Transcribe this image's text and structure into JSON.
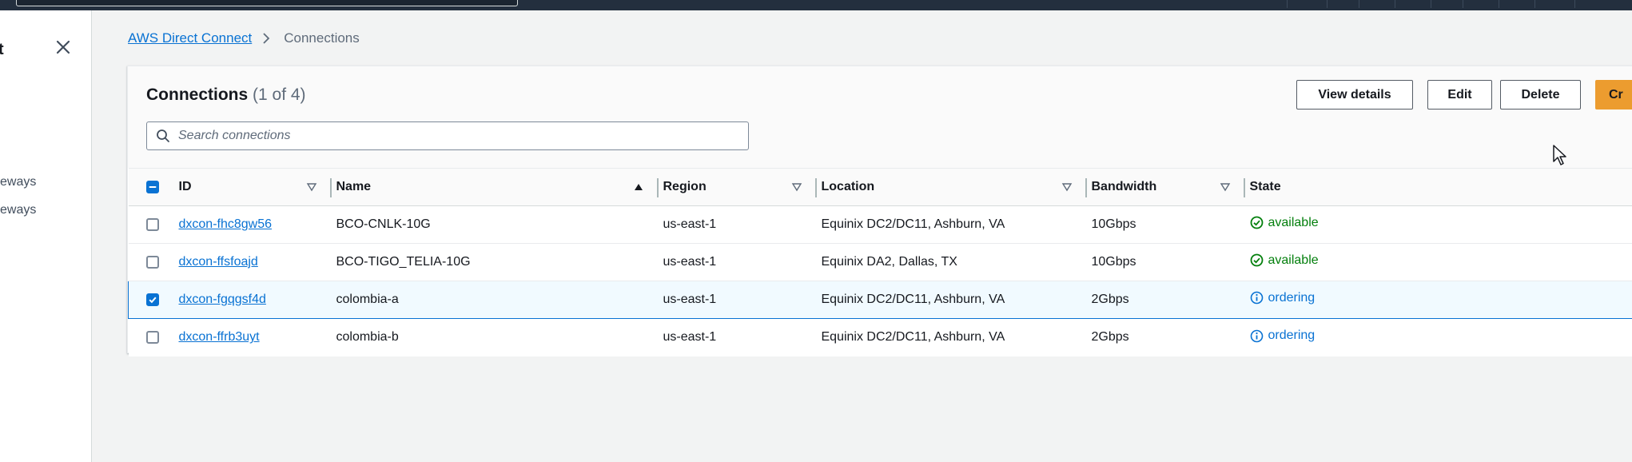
{
  "sidenav": {
    "title_fragment": "t",
    "items": [
      "eways",
      "eways"
    ]
  },
  "breadcrumb": {
    "root": "AWS Direct Connect",
    "current": "Connections"
  },
  "panel": {
    "title": "Connections",
    "count": "(1 of 4)",
    "buttons": {
      "view_details": "View details",
      "edit": "Edit",
      "delete": "Delete",
      "create": "Cr"
    },
    "search_placeholder": "Search connections"
  },
  "table": {
    "columns": [
      "ID",
      "Name",
      "Region",
      "Location",
      "Bandwidth",
      "State"
    ],
    "sorted_column": "Name",
    "rows": [
      {
        "id": "dxcon-fhc8gw56",
        "name": "BCO-CNLK-10G",
        "region": "us-east-1",
        "location": "Equinix DC2/DC11, Ashburn, VA",
        "bandwidth": "10Gbps",
        "state": "available",
        "selected": false
      },
      {
        "id": "dxcon-ffsfoajd",
        "name": "BCO-TIGO_TELIA-10G",
        "region": "us-east-1",
        "location": "Equinix DA2, Dallas, TX",
        "bandwidth": "10Gbps",
        "state": "available",
        "selected": false
      },
      {
        "id": "dxcon-fgqgsf4d",
        "name": "colombia-a",
        "region": "us-east-1",
        "location": "Equinix DC2/DC11, Ashburn, VA",
        "bandwidth": "2Gbps",
        "state": "ordering",
        "selected": true
      },
      {
        "id": "dxcon-ffrb3uyt",
        "name": "colombia-b",
        "region": "us-east-1",
        "location": "Equinix DC2/DC11, Ashburn, VA",
        "bandwidth": "2Gbps",
        "state": "ordering",
        "selected": false
      }
    ]
  },
  "colors": {
    "accent": "#0972d3",
    "primary_button": "#ec9c2f",
    "status_available": "#037f0c",
    "status_ordering": "#0972d3",
    "topbar": "#232f3e"
  },
  "icons": {
    "close": "close-icon",
    "breadcrumb_separator": "chevron-right-icon",
    "search": "search-icon",
    "sort_default": "caret-down-outline-icon",
    "sort_active": "caret-up-filled-icon",
    "available": "status-success-icon",
    "ordering": "status-info-icon",
    "cursor": "mouse-pointer-icon"
  }
}
